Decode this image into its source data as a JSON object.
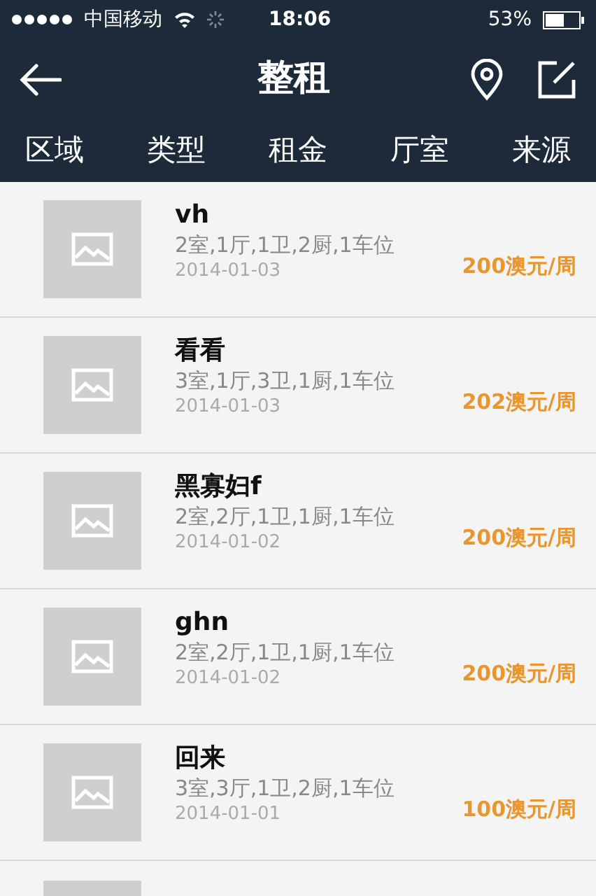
{
  "status_bar": {
    "carrier": "中国移动",
    "time": "18:06",
    "battery": "53%"
  },
  "nav": {
    "title": "整租"
  },
  "filters": [
    {
      "label": "区域"
    },
    {
      "label": "类型"
    },
    {
      "label": "租金"
    },
    {
      "label": "厅室"
    },
    {
      "label": "来源"
    }
  ],
  "listings": [
    {
      "title": "vh",
      "rooms": "2室,1厅,1卫,2厨,1车位",
      "date": "2014-01-03",
      "price": "200澳元/周"
    },
    {
      "title": "看看",
      "rooms": "3室,1厅,3卫,1厨,1车位",
      "date": "2014-01-03",
      "price": "202澳元/周"
    },
    {
      "title": "黑寡妇f",
      "rooms": "2室,2厅,1卫,1厨,1车位",
      "date": "2014-01-02",
      "price": "200澳元/周"
    },
    {
      "title": "ghn",
      "rooms": "2室,2厅,1卫,1厨,1车位",
      "date": "2014-01-02",
      "price": "200澳元/周"
    },
    {
      "title": "回来",
      "rooms": "3室,3厅,1卫,2厨,1车位",
      "date": "2014-01-01",
      "price": "100澳元/周"
    }
  ]
}
